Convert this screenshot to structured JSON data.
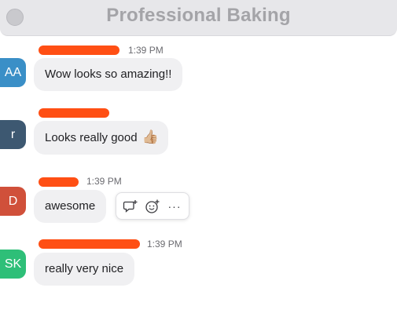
{
  "window": {
    "title": "Professional Baking"
  },
  "colors": {
    "name_redaction": "#ff4f14",
    "avatar_aa": "#3a8fc7",
    "avatar_r": "#3d5871",
    "avatar_d": "#d0503a",
    "avatar_sk": "#2ebf78"
  },
  "messages": [
    {
      "initials": "AA",
      "time": "1:39 PM",
      "text": "Wow looks so amazing!!"
    },
    {
      "initials": "r",
      "time": "",
      "text": "Looks really good",
      "emoji": "👍🏼"
    },
    {
      "initials": "D",
      "time": "1:39 PM",
      "text": "awesome"
    },
    {
      "initials": "SK",
      "time": "1:39 PM",
      "text": "really very nice"
    }
  ],
  "hover_toolbar": {
    "icons": [
      "reply-thread-icon",
      "add-reaction-icon",
      "more-options-icon"
    ],
    "more_label": "···"
  }
}
